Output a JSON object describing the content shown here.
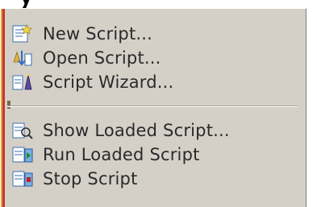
{
  "title_fragment": "y",
  "menu": {
    "items": [
      {
        "label": "New Script...",
        "icon": "new-script-icon"
      },
      {
        "label": "Open Script...",
        "icon": "open-script-icon"
      },
      {
        "label": "Script Wizard...",
        "icon": "script-wizard-icon"
      },
      {
        "label": "Show Loaded Script...",
        "icon": "show-loaded-script-icon"
      },
      {
        "label": "Run Loaded Script",
        "icon": "run-loaded-script-icon"
      },
      {
        "label": "Stop Script",
        "icon": "stop-script-icon"
      }
    ]
  },
  "colors": {
    "menu_bg": "#d4d0c8",
    "text": "#2a2a2a",
    "stripe_orange": "#e8a23a",
    "stripe_red": "#c03a2b"
  }
}
